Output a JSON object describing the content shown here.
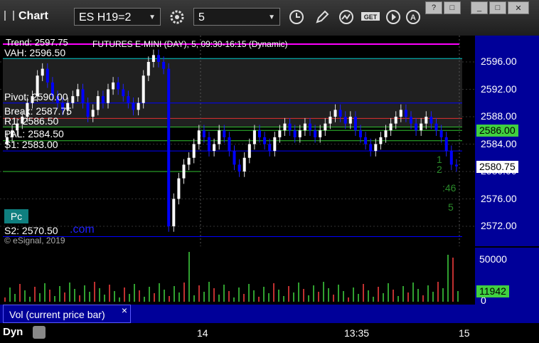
{
  "toolbar": {
    "title": "Chart",
    "symbol": "ES H19=2",
    "interval": "5"
  },
  "window_buttons": [
    "?",
    "□",
    "_",
    "□",
    "✕"
  ],
  "chart": {
    "header_text": "FUTURES E-MINI (DAY), 5, 09:30-16:15 (Dynamic)",
    "levels": [
      {
        "label": "VAH: 2596.50",
        "value": 2596.5,
        "color": "#00c8c8"
      },
      {
        "label": "Pivot: 2590.00",
        "value": 2590.0,
        "color": "#0000ff"
      },
      {
        "label": "Break: 2587.75",
        "value": 2587.75,
        "color": "#e03030"
      },
      {
        "label": "R1: 2586.50",
        "value": 2586.5,
        "color": "#30c030"
      },
      {
        "label": "PAL: 2584.50",
        "value": 2584.5,
        "color": "#30c030"
      },
      {
        "label": "S1: 2583.00",
        "value": 2583.0,
        "color": "#0000ff"
      },
      {
        "label": "S2: 2570.50",
        "value": 2570.5,
        "color": "#0000ff"
      }
    ],
    "trend_label": "Trend: 2597.75",
    "pc_label": "Pc",
    "com_label": ".com",
    "copyright": "© eSignal, 2019",
    "ticks": [
      "2596.00",
      "2592.00",
      "2588.00",
      "2584.00",
      "2580.00",
      "2576.00",
      "2572.00"
    ],
    "last_price": "2580.75",
    "green_price": "2586.00",
    "countdown": [
      "1",
      "2",
      ":46",
      "5"
    ],
    "vol_axis_label": "50000",
    "vol_axis_zero": "0",
    "vol_value": "11942",
    "vol_tab": "Vol (current price bar)",
    "time_labels": [
      "14",
      "13:35",
      "15"
    ],
    "dyn_label": "Dyn"
  },
  "colors": {
    "up_candle": "#ffffff",
    "down_candle": "#0000ff",
    "axis_bg": "#000099",
    "magenta_line": "#ff00ff"
  }
}
